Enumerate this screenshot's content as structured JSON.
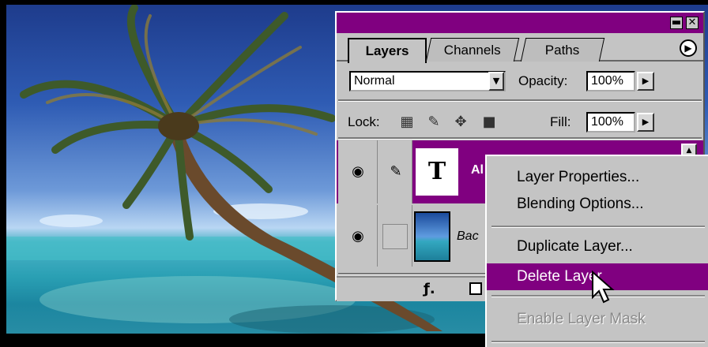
{
  "tabs": [
    {
      "label": "Layers",
      "active": true
    },
    {
      "label": "Channels",
      "active": false
    },
    {
      "label": "Paths",
      "active": false
    }
  ],
  "blend_mode": {
    "value": "Normal"
  },
  "opacity": {
    "label": "Opacity:",
    "value": "100%"
  },
  "lock": {
    "label": "Lock:"
  },
  "fill": {
    "label": "Fill:",
    "value": "100%"
  },
  "layers": [
    {
      "thumb_text": "T",
      "name": "Al",
      "selected": true
    },
    {
      "name": "Bac",
      "selected": false
    }
  ],
  "context_menu": {
    "items": [
      {
        "label": "Layer Properties...",
        "state": "normal"
      },
      {
        "label": "Blending Options...",
        "state": "normal"
      },
      {
        "label": "Duplicate Layer...",
        "state": "normal"
      },
      {
        "label": "Delete Layer",
        "state": "highlighted"
      },
      {
        "label": "Enable Layer Mask",
        "state": "disabled"
      }
    ]
  },
  "colors": {
    "title_bar": "#800080",
    "selection": "#800080",
    "panel": "#c4c4c4"
  },
  "icons": {
    "palette_menu": "arrow-right-circle-icon",
    "visibility": "eye-icon",
    "brush": "brush-icon",
    "layer_style": "layer-style-icon"
  }
}
